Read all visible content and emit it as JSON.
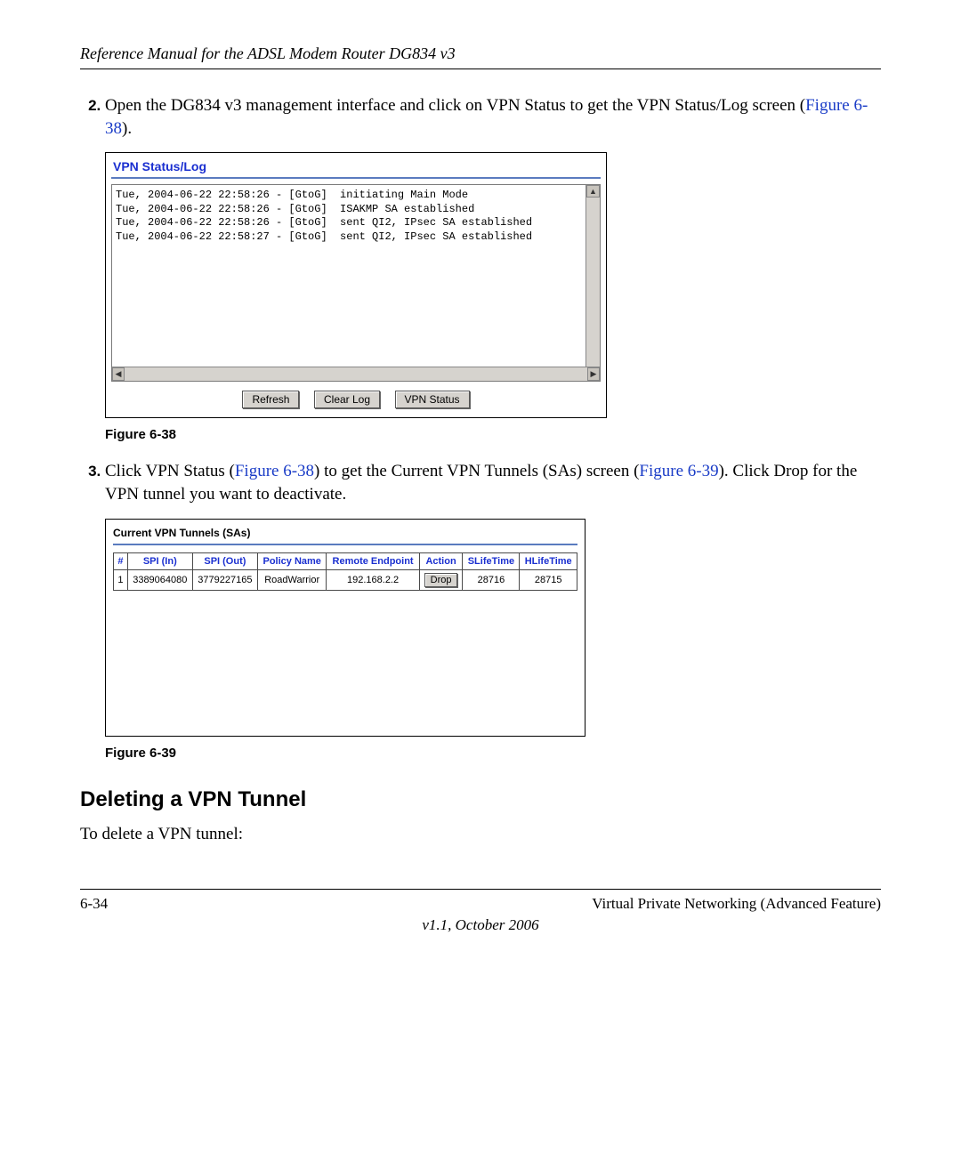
{
  "header": {
    "title": "Reference Manual for the ADSL Modem Router DG834 v3"
  },
  "step2": {
    "marker": "2.",
    "text_a": "Open the DG834 v3 management interface and click on VPN Status to get the VPN Status/Log screen (",
    "figref": "Figure 6-38",
    "text_b": ")."
  },
  "fig38": {
    "title": "VPN Status/Log",
    "log_lines": [
      "Tue, 2004-06-22 22:58:26 - [GtoG]  initiating Main Mode",
      "Tue, 2004-06-22 22:58:26 - [GtoG]  ISAKMP SA established",
      "Tue, 2004-06-22 22:58:26 - [GtoG]  sent QI2, IPsec SA established",
      "Tue, 2004-06-22 22:58:27 - [GtoG]  sent QI2, IPsec SA established"
    ],
    "buttons": {
      "refresh": "Refresh",
      "clear": "Clear Log",
      "status": "VPN Status"
    },
    "caption": "Figure 6-38"
  },
  "step3": {
    "marker": "3.",
    "text_a": "Click VPN Status (",
    "figref1": "Figure 6-38",
    "text_b": ") to get the Current VPN Tunnels (SAs) screen (",
    "figref2": "Figure 6-39",
    "text_c": "). Click Drop for the VPN tunnel you want to deactivate."
  },
  "fig39": {
    "title": "Current VPN Tunnels (SAs)",
    "headers": [
      "#",
      "SPI (In)",
      "SPI (Out)",
      "Policy Name",
      "Remote Endpoint",
      "Action",
      "SLifeTime",
      "HLifeTime"
    ],
    "row": {
      "num": "1",
      "spi_in": "3389064080",
      "spi_out": "3779227165",
      "policy": "RoadWarrior",
      "remote": "192.168.2.2",
      "action": "Drop",
      "slife": "28716",
      "hlife": "28715"
    },
    "caption": "Figure 6-39"
  },
  "section_heading": "Deleting a VPN Tunnel",
  "section_intro": "To delete a VPN tunnel:",
  "footer": {
    "left": "6-34",
    "right": "Virtual Private Networking (Advanced Feature)",
    "center": "v1.1, October 2006"
  }
}
